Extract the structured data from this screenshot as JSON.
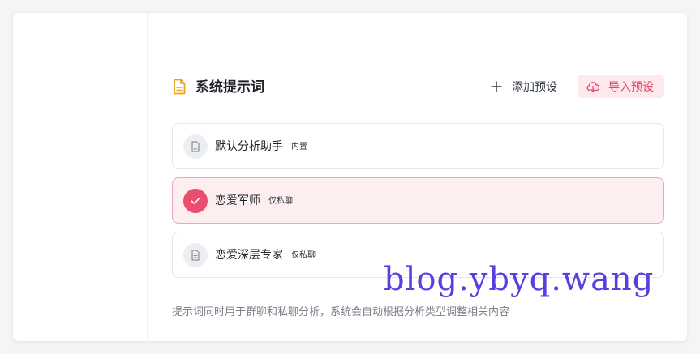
{
  "section": {
    "title": "系统提示词",
    "title_icon": "document-icon",
    "add_label": "添加预设",
    "import_label": "导入预设"
  },
  "presets": [
    {
      "name": "默认分析助手",
      "tag": "内置",
      "selected": false,
      "icon": "file-icon"
    },
    {
      "name": "恋爱军师",
      "tag": "仅私聊",
      "selected": true,
      "icon": "check-icon"
    },
    {
      "name": "恋爱深层专家",
      "tag": "仅私聊",
      "selected": false,
      "icon": "file-icon"
    }
  ],
  "footer_note": "提示词同时用于群聊和私聊分析，系统会自动根据分析类型调整相关内容",
  "watermark": "blog.ybyq.wang",
  "colors": {
    "accent": "#ea4d6d",
    "accent_light": "#fde8ec",
    "title_icon": "#f0a21c"
  }
}
